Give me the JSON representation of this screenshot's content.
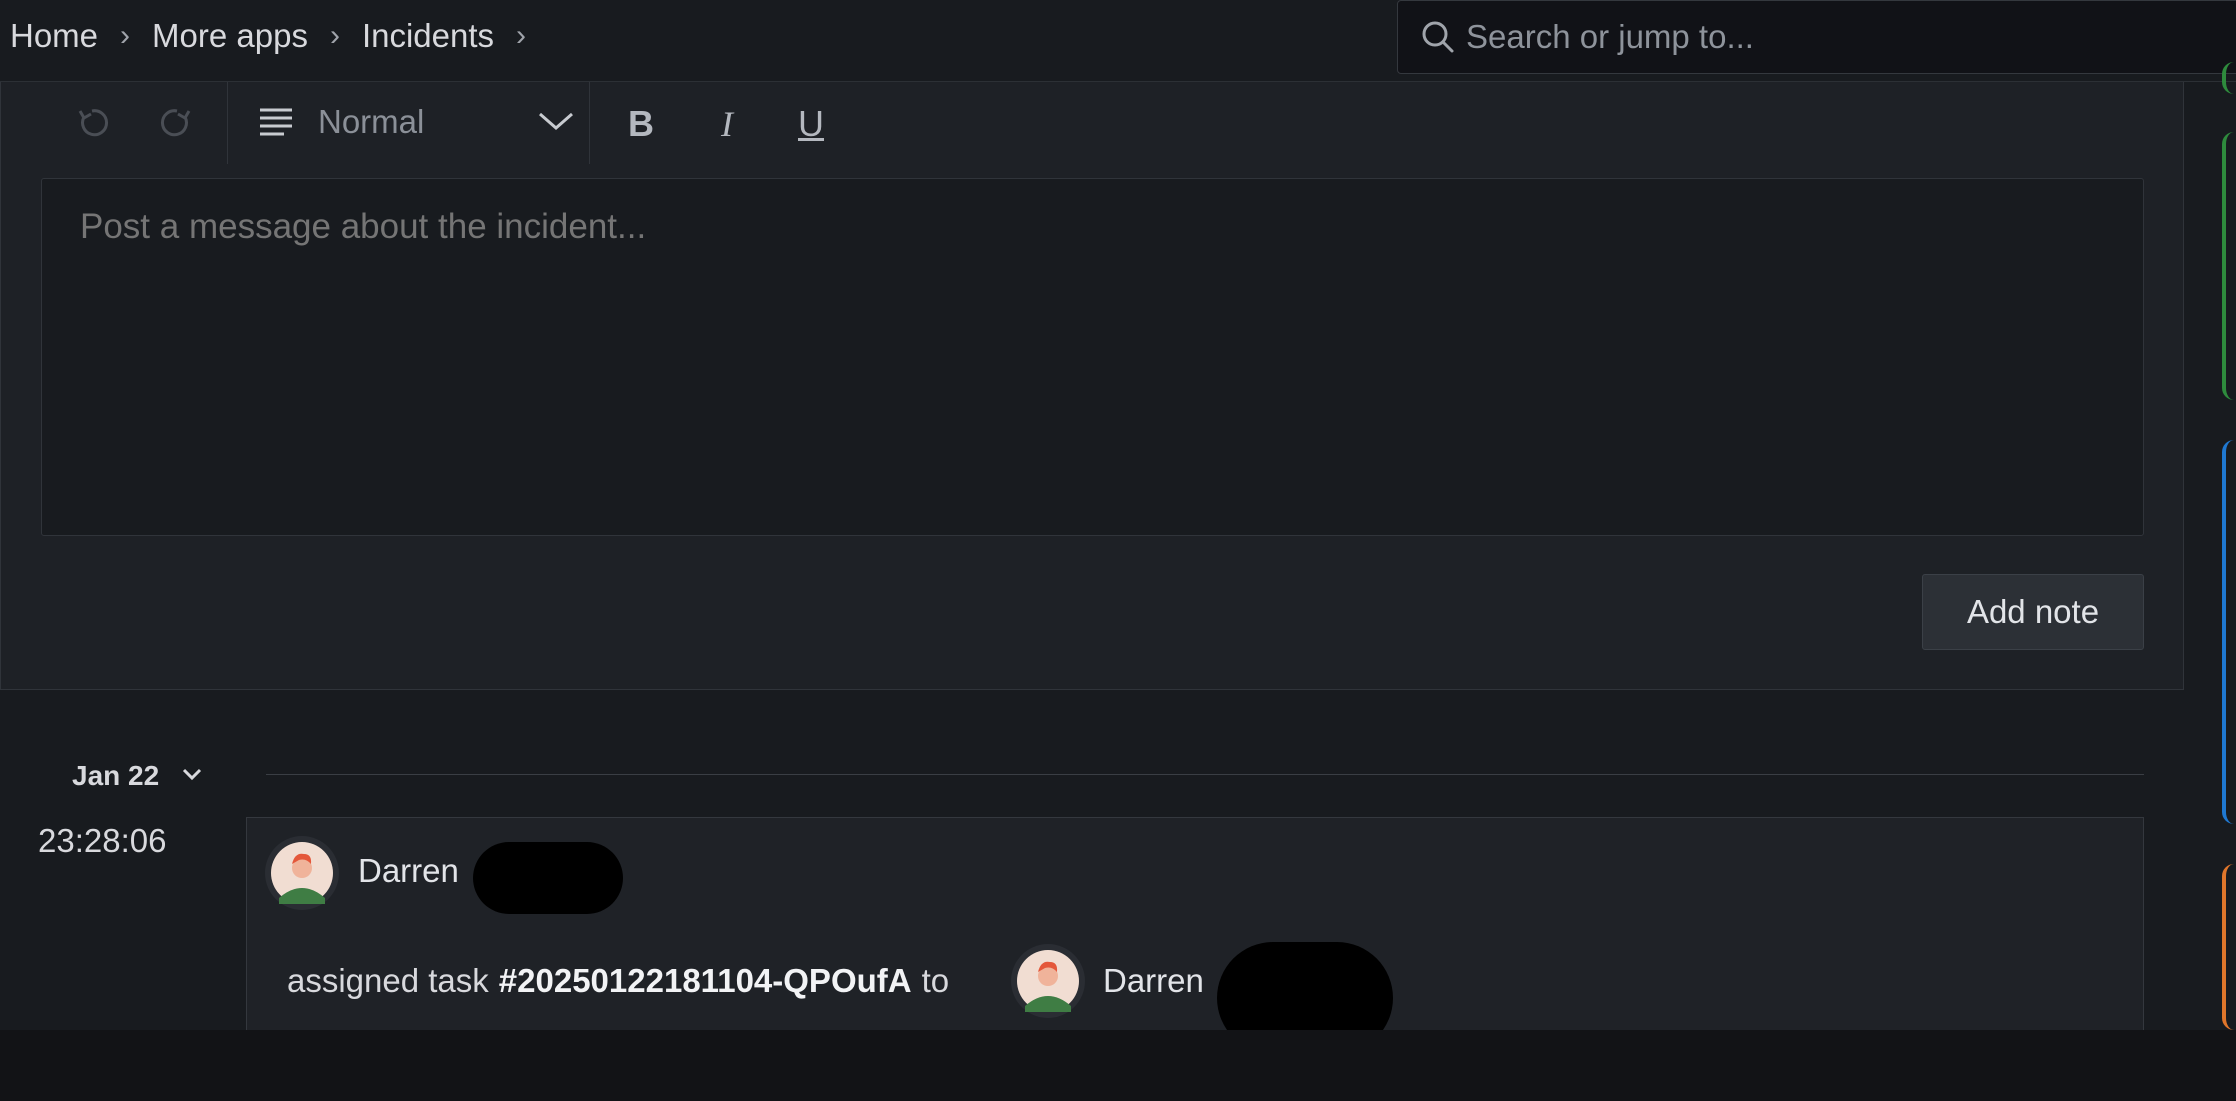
{
  "breadcrumb": {
    "items": [
      "Home",
      "More apps",
      "Incidents"
    ],
    "separator": "›"
  },
  "search": {
    "placeholder": "Search or jump to..."
  },
  "editor": {
    "format_selected": "Normal",
    "bold_label": "B",
    "italic_label": "I",
    "underline_label": "U",
    "message_placeholder": "Post a message about the incident...",
    "add_note_label": "Add note"
  },
  "timeline": {
    "date": "Jan 22",
    "events": [
      {
        "time": "23:28:06",
        "author": "Darren",
        "action_prefix": "assigned task",
        "task_id": "#20250122181104-QPOufA",
        "action_suffix": "to",
        "assignee": "Darren"
      }
    ]
  },
  "colors": {
    "accent_green": "#2e8b3d",
    "accent_blue": "#1f78d1",
    "accent_orange": "#e0762b",
    "background": "#181b1f"
  }
}
